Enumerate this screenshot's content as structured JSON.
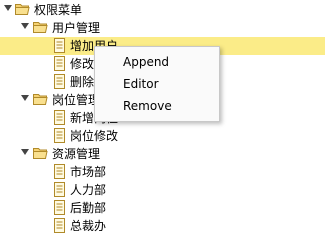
{
  "tree": {
    "root": {
      "label": "权限菜单"
    },
    "groups": [
      {
        "label": "用户管理",
        "items": [
          {
            "label": "增加用户",
            "selected": true
          },
          {
            "label": "修改用户"
          },
          {
            "label": "删除用户"
          }
        ]
      },
      {
        "label": "岗位管理",
        "items": [
          {
            "label": "新增岗位"
          },
          {
            "label": "岗位修改"
          }
        ]
      },
      {
        "label": "资源管理",
        "items": [
          {
            "label": "市场部"
          },
          {
            "label": "人力部"
          },
          {
            "label": "后勤部"
          },
          {
            "label": "总裁办"
          }
        ]
      }
    ]
  },
  "context_menu": {
    "items": [
      {
        "label": "Append"
      },
      {
        "label": "Editor"
      },
      {
        "label": "Remove"
      }
    ]
  },
  "colors": {
    "selected_bg": "#fbec88",
    "folder_fill": "#f6d272",
    "folder_stroke": "#b08a2a"
  }
}
